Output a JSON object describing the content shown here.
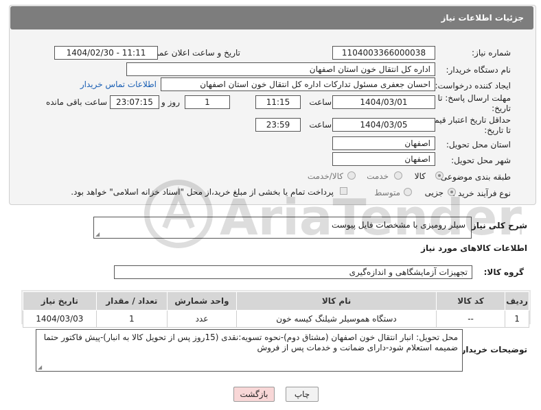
{
  "header": {
    "title": "جزئیات اطلاعات نیاز"
  },
  "form": {
    "need_number_label": "شماره نیاز:",
    "need_number": "1104003366000038",
    "announce_label": "تاریخ و ساعت اعلان عمومی:",
    "announce_value": "1404/02/30 - 11:11",
    "buyer_org_label": "نام دستگاه خریدار:",
    "buyer_org": "اداره کل انتقال خون استان اصفهان",
    "creator_label": "ایجاد کننده درخواست:",
    "creator": "احسان جعفری مسئول تدارکات اداره کل انتقال خون استان اصفهان",
    "contact_link": "اطلاعات تماس خریدار",
    "deadline_label": "مهلت ارسال پاسخ: تا تاریخ:",
    "deadline_date": "1404/03/01",
    "hour_label": "ساعت",
    "deadline_time": "11:15",
    "days_value": "1",
    "days_label": "روز و",
    "remaining_time": "23:07:15",
    "remaining_label": "ساعت باقی مانده",
    "price_validity_label": "حداقل تاریخ اعتبار قیمت: تا تاریخ:",
    "price_validity_date": "1404/03/05",
    "price_validity_time": "23:59",
    "province_label": "استان محل تحویل:",
    "province": "اصفهان",
    "city_label": "شهر محل تحویل:",
    "city": "اصفهان",
    "category_label": "طبقه بندی موضوعی:",
    "category_options": [
      "کالا",
      "خدمت",
      "کالا/خدمت"
    ],
    "process_label": "نوع فرآیند خرید :",
    "process_options": [
      "جزیی",
      "متوسط"
    ],
    "payment_note": "پرداخت تمام یا بخشی از مبلغ خرید،از محل \"اسناد خزانه اسلامی\" خواهد بود."
  },
  "description": {
    "label": "شرح کلی نیاز:",
    "value": "سیلر رومیزی با مشخصات فایل پیوست"
  },
  "goods": {
    "section_title": "اطلاعات کالاهای مورد نیاز",
    "group_label": "گروه کالا:",
    "group_value": "تجهیزات آزمایشگاهی و اندازه‌گیری",
    "columns": [
      "ردیف",
      "کد کالا",
      "نام کالا",
      "واحد شمارش",
      "تعداد / مقدار",
      "تاریخ نیاز"
    ],
    "rows": [
      [
        "1",
        "--",
        "دستگاه هموسیلر شیلنگ کیسه خون",
        "عدد",
        "1",
        "1404/03/03"
      ]
    ]
  },
  "buyer_notes": {
    "label": "توضیحات خریدار:",
    "value": "محل تحویل: انبار انتقال خون اصفهان (مشتاق دوم)-نحوه تسویه:نقدی (15روز پس از تحویل کالا به انبار)-پیش فاکتور حتما ضمیمه استعلام شود-دارای ضمانت و خدمات پس از فروش"
  },
  "buttons": {
    "print": "چاپ",
    "back": "بازگشت"
  },
  "watermark": {
    "text": "AriaTender.neT"
  },
  "colors": {
    "header_bg": "#7d7d7d",
    "link": "#1a5fb4",
    "back_button": "#f8d7d7"
  }
}
